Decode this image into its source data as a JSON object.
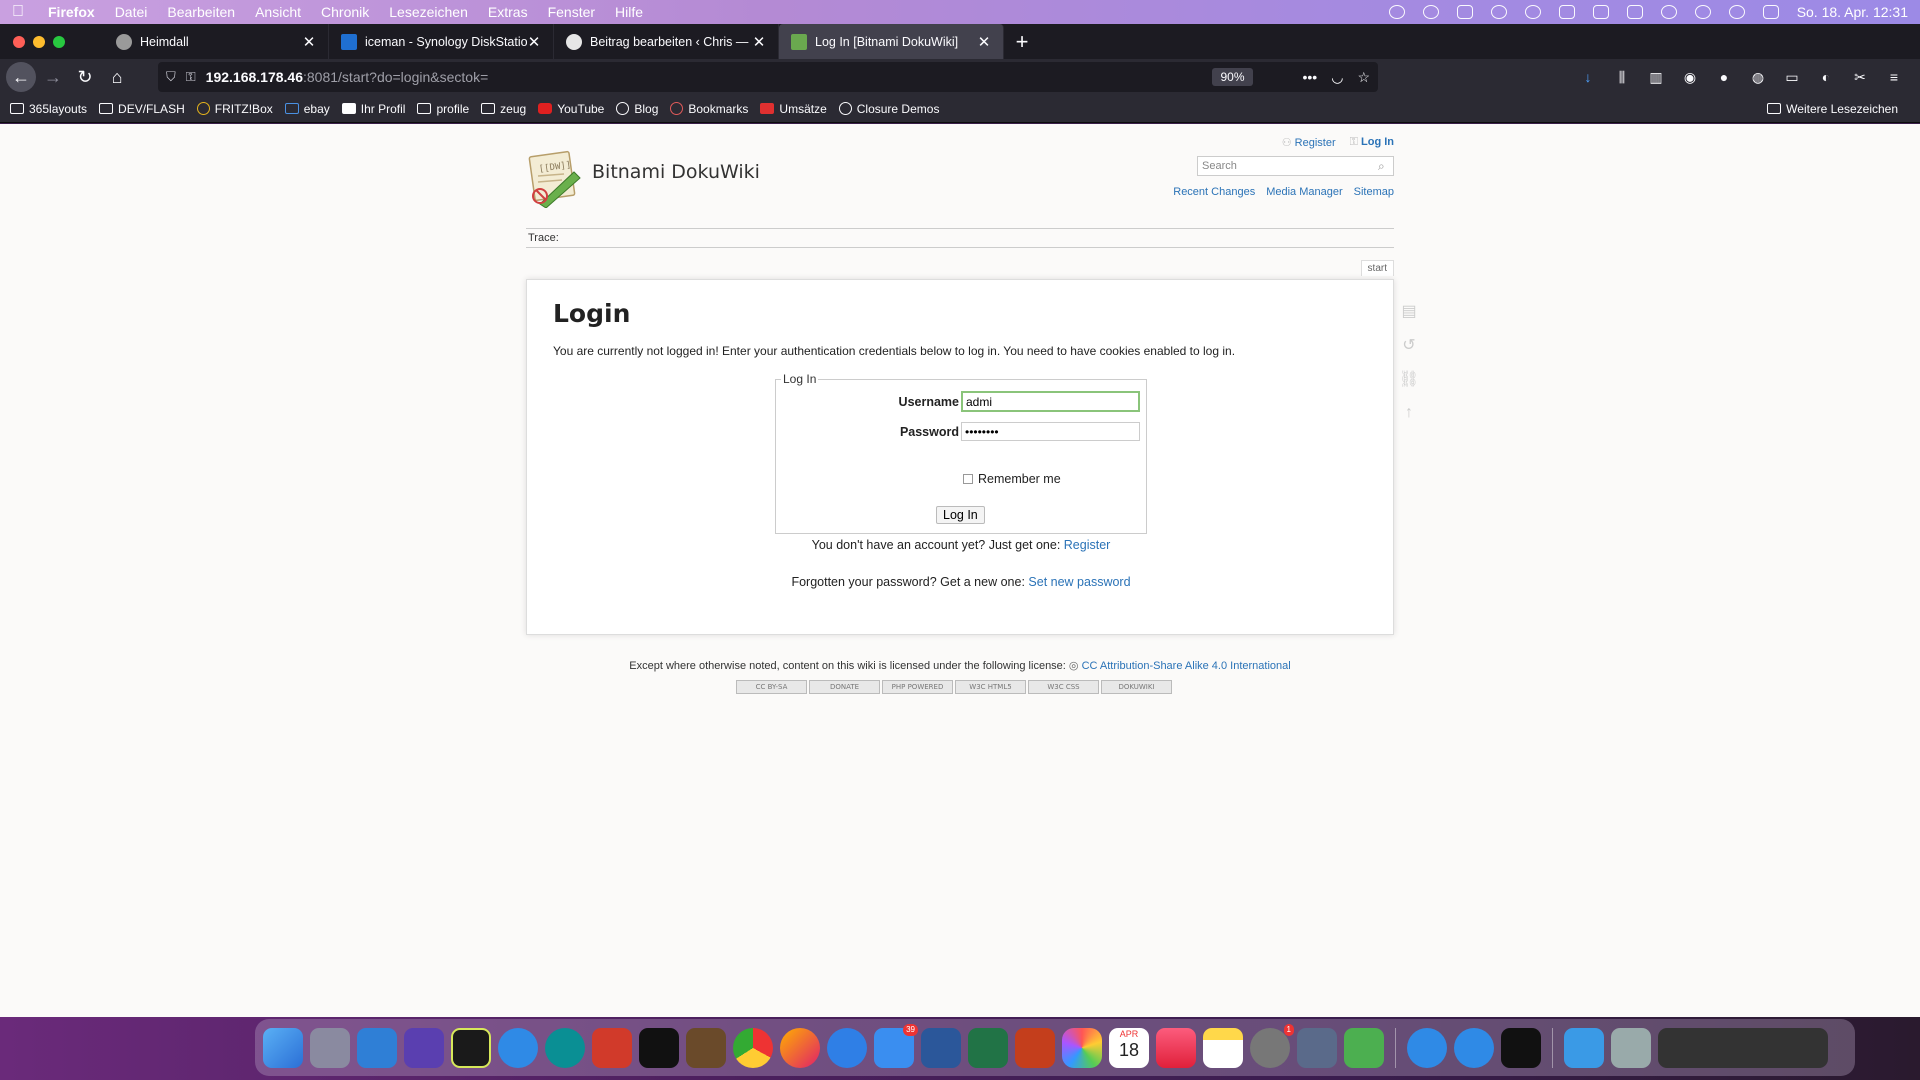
{
  "menubar": {
    "app": "Firefox",
    "items": [
      "Datei",
      "Bearbeiten",
      "Ansicht",
      "Chronik",
      "Lesezeichen",
      "Extras",
      "Fenster",
      "Hilfe"
    ],
    "clock": "So. 18. Apr.  12:31"
  },
  "tabs": [
    {
      "title": "Heimdall",
      "favicon_color": "#9a9a9a"
    },
    {
      "title": "iceman - Synology DiskStation",
      "favicon_color": "#1f6fd1"
    },
    {
      "title": "Beitrag bearbeiten ‹ Chris — W",
      "favicon_color": "#e6e6e6"
    },
    {
      "title": "Log In [Bitnami DokuWiki]",
      "favicon_color": "#6aa84f"
    }
  ],
  "urlbar": {
    "host": "192.168.178.46",
    "path": ":8081/start?do=login&sectok=",
    "zoom": "90%"
  },
  "bookmarks": {
    "items": [
      "365layouts",
      "DEV/FLASH",
      "FRITZ!Box",
      "ebay",
      "Ihr Profil",
      "profile",
      "zeug",
      "YouTube",
      "Blog",
      "Bookmarks",
      "Umsätze",
      "Closure Demos"
    ],
    "more": "Weitere Lesezeichen"
  },
  "wiki": {
    "sitename": "Bitnami DokuWiki",
    "usertools": {
      "register": "Register",
      "login": "Log In"
    },
    "search_placeholder": "Search",
    "sitetools": {
      "recent": "Recent Changes",
      "media": "Media Manager",
      "sitemap": "Sitemap"
    },
    "trace_label": "Trace:",
    "page_id": "start",
    "heading": "Login",
    "intro": "You are currently not logged in! Enter your authentication credentials below to log in. You need to have cookies enabled to log in.",
    "form": {
      "legend": "Log In",
      "username_label": "Username",
      "username_value": "admi",
      "password_label": "Password",
      "password_value": "••••••••",
      "remember_label": "Remember me",
      "submit_label": "Log In"
    },
    "no_account_text": "You don't have an account yet? Just get one: ",
    "register_link": "Register",
    "forgot_text": "Forgotten your password? Get a new one: ",
    "set_password_link": "Set new password",
    "license_text": "Except where otherwise noted, content on this wiki is licensed under the following license: ",
    "license_link": "CC Attribution-Share Alike 4.0 International",
    "badges": [
      "CC BY-SA",
      "DONATE",
      "PHP POWERED",
      "W3C HTML5",
      "W3C CSS",
      "DOKUWIKI"
    ]
  },
  "dock": {
    "mail_badge": "39",
    "calendar_month": "APR",
    "calendar_day": "18",
    "settings_badge": "1"
  }
}
